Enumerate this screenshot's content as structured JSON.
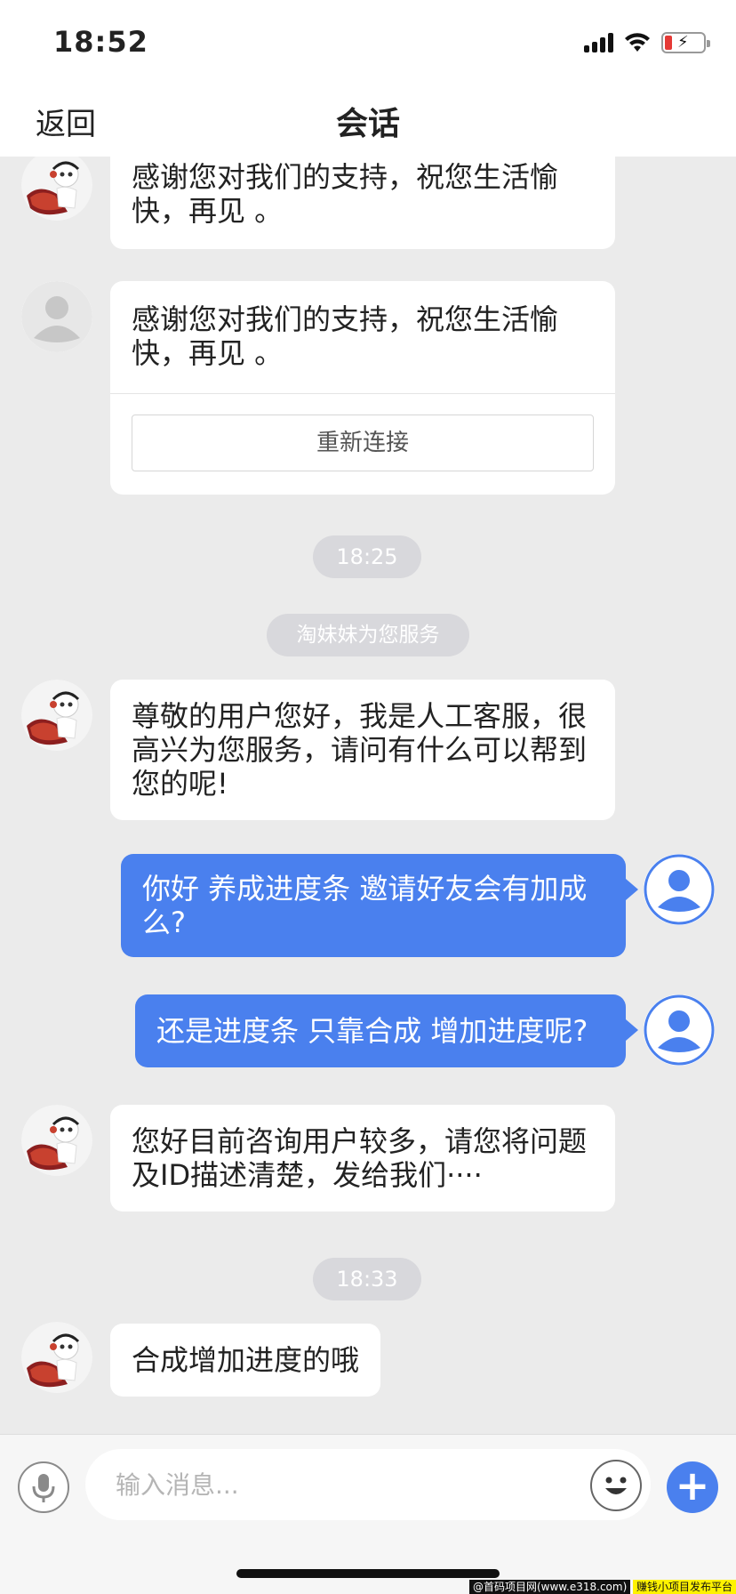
{
  "status_bar": {
    "time": "18:52"
  },
  "nav": {
    "back_label": "返回",
    "title": "会话"
  },
  "messages": [
    {
      "type": "agent",
      "text": "感谢您对我们的支持，祝您生活愉快，再见 。"
    },
    {
      "type": "system_agent",
      "text": "感谢您对我们的支持，祝您生活愉快，再见 。",
      "button_label": "重新连接"
    },
    {
      "type": "time",
      "text": "18:25"
    },
    {
      "type": "notice",
      "text": "淘妹妹为您服务"
    },
    {
      "type": "agent",
      "text": "尊敬的用户您好，我是人工客服，很高兴为您服务，请问有什么可以帮到您的呢!"
    },
    {
      "type": "user",
      "text": "你好 养成进度条 邀请好友会有加成么?"
    },
    {
      "type": "user",
      "text": "还是进度条 只靠合成 增加进度呢?"
    },
    {
      "type": "agent",
      "text": "您好目前咨询用户较多，请您将问题及ID描述清楚，发给我们····"
    },
    {
      "type": "time",
      "text": "18:33"
    },
    {
      "type": "agent",
      "text": "合成增加进度的哦"
    }
  ],
  "input": {
    "placeholder": "输入消息..."
  },
  "watermark": {
    "left": "@首码项目网(www.e318.com)",
    "right": "赚钱小项目发布平台"
  },
  "colors": {
    "accent": "#4a80ee",
    "background": "#ebebeb",
    "bubble_in": "#ffffff"
  },
  "icons": {
    "mic": "microphone-icon",
    "emoji": "emoji-icon",
    "plus": "plus-icon",
    "agent_avatar": "headset-agent-avatar",
    "user_avatar": "person-icon"
  }
}
